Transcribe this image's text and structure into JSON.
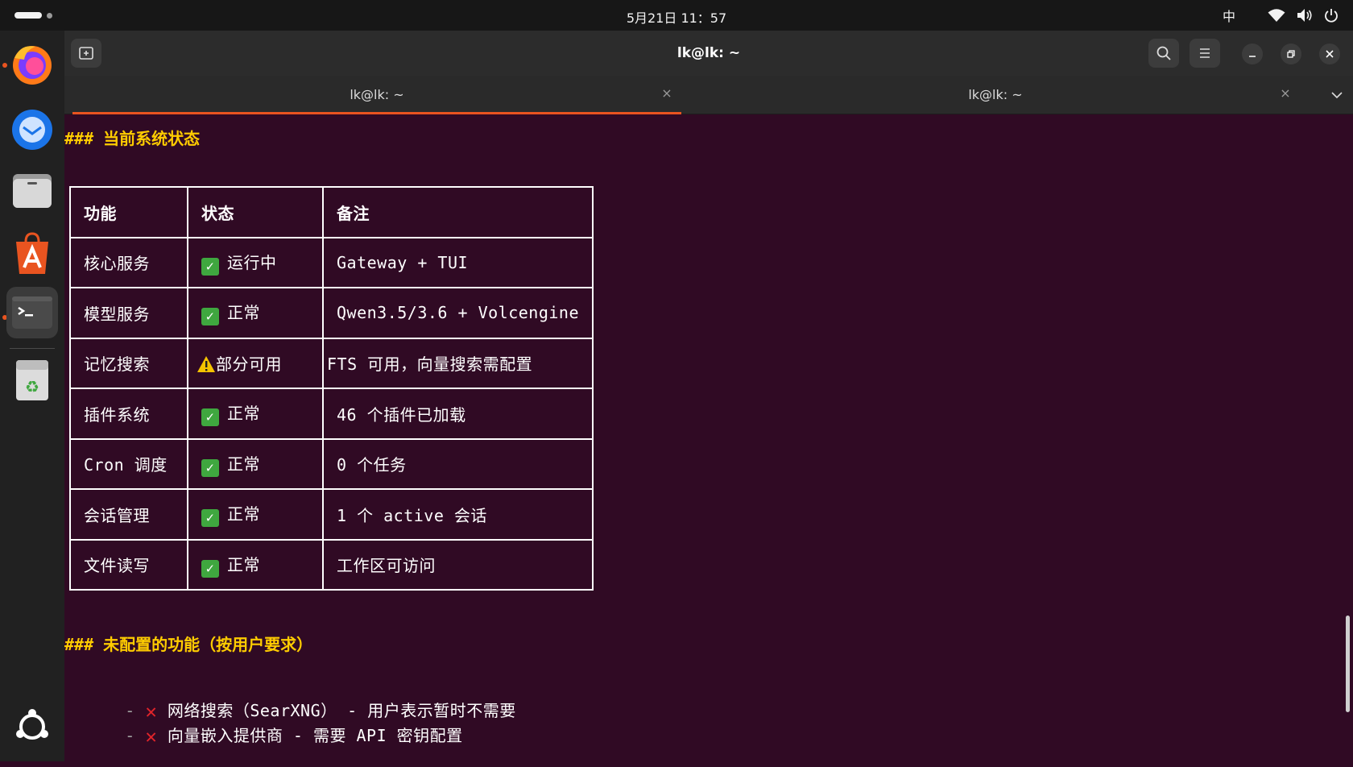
{
  "topbar": {
    "clock": "5月21日 11：57",
    "ime": "中"
  },
  "dock": {
    "items": [
      "firefox-icon",
      "thunderbird-icon",
      "files-icon",
      "app-center-icon",
      "terminal-icon",
      "trash-icon",
      "ubuntu-logo-icon"
    ]
  },
  "window": {
    "title": "lk@lk: ~",
    "tabs": [
      {
        "label": "lk@lk: ~",
        "active": true
      },
      {
        "label": "lk@lk: ~",
        "active": false
      }
    ],
    "tab_close": "×"
  },
  "terminal": {
    "heading1": "### 当前系统状态",
    "table": {
      "headers": [
        "功能",
        "状态",
        "备注"
      ],
      "rows": [
        {
          "feature": "核心服务",
          "status": "运行中",
          "icon": "check",
          "note": "Gateway + TUI"
        },
        {
          "feature": "模型服务",
          "status": "正常",
          "icon": "check",
          "note": "Qwen3.5/3.6 + Volcengine"
        },
        {
          "feature": "记忆搜索",
          "status": "部分可用",
          "icon": "warning",
          "note": "FTS 可用，向量搜索需配置"
        },
        {
          "feature": "插件系统",
          "status": "正常",
          "icon": "check",
          "note": "46 个插件已加载"
        },
        {
          "feature": "Cron 调度",
          "status": "正常",
          "icon": "check",
          "note": "0 个任务"
        },
        {
          "feature": "会话管理",
          "status": "正常",
          "icon": "check",
          "note": "1 个 active 会话"
        },
        {
          "feature": "文件读写",
          "status": "正常",
          "icon": "check",
          "note": "工作区可访问"
        }
      ]
    },
    "heading2": "### 未配置的功能（按用户要求）",
    "bullets": [
      {
        "dash": "-",
        "text": "网络搜索（SearXNG） - 用户表示暂时不需要"
      },
      {
        "dash": "-",
        "text": "向量嵌入提供商 - 需要 API 密钥配置"
      }
    ]
  },
  "colors": {
    "terminal_bg": "#300a24",
    "heading": "#ffcc00",
    "accent": "#e95420",
    "check": "#3fa73f",
    "cross": "#e0242a"
  }
}
